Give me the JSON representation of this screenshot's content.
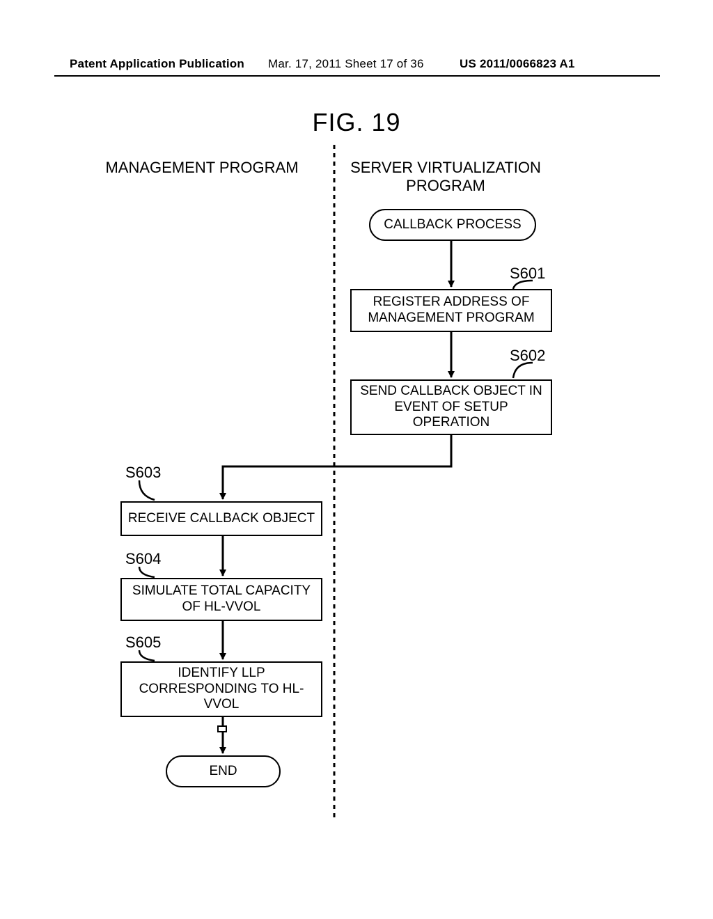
{
  "header": {
    "left": "Patent Application Publication",
    "mid": "Mar. 17, 2011  Sheet 17 of 36",
    "right": "US 2011/0066823 A1"
  },
  "figure_title": "FIG. 19",
  "columns": {
    "left": "MANAGEMENT PROGRAM",
    "right": "SERVER VIRTUALIZATION PROGRAM"
  },
  "nodes": {
    "callback_process": "CALLBACK PROCESS",
    "s601": "REGISTER ADDRESS OF MANAGEMENT PROGRAM",
    "s602": "SEND CALLBACK OBJECT IN EVENT OF SETUP OPERATION",
    "s603": "RECEIVE CALLBACK OBJECT",
    "s604": "SIMULATE TOTAL CAPACITY OF HL-VVOL",
    "s605": "IDENTIFY LLP CORRESPONDING TO HL-VVOL",
    "end": "END"
  },
  "labels": {
    "s601": "S601",
    "s602": "S602",
    "s603": "S603",
    "s604": "S604",
    "s605": "S605"
  }
}
